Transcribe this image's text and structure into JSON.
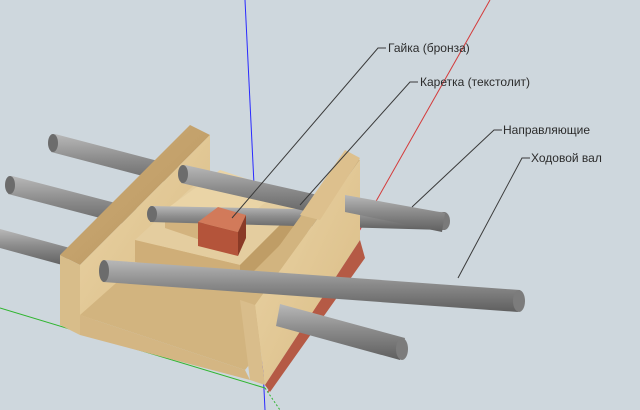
{
  "labels": {
    "nut": "Гайка (бронза)",
    "carriage": "Каретка (текстолит)",
    "guides": "Направляющие",
    "lead_screw": "Ходовой вал"
  },
  "colors": {
    "background": "#ced7dd",
    "wood": "#e2c898",
    "wood_shade": "#cfae78",
    "rod": "#8e8e8e",
    "nut": "#b8583a",
    "axis_blue": "#2a2aff",
    "axis_red": "#d43a3a",
    "axis_green": "#2fb52f"
  }
}
